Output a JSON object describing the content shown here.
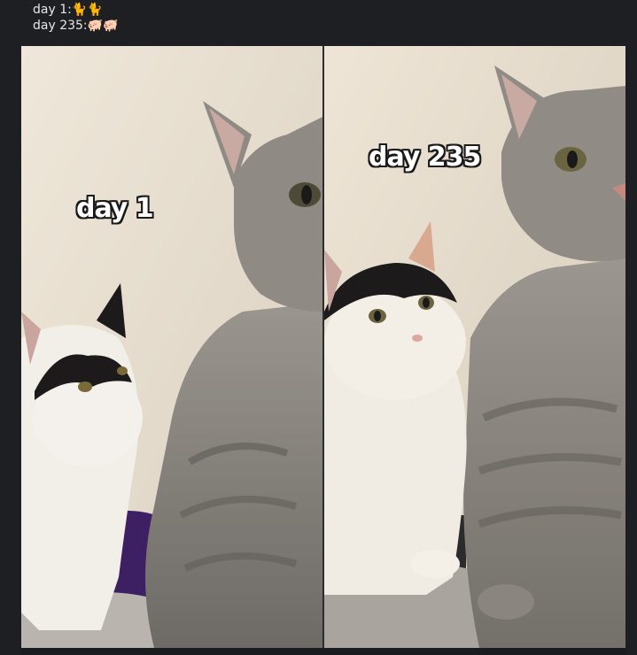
{
  "message": {
    "line1": "day 1:🐈🐈",
    "line2": "day 235:🐖🐖"
  },
  "panels": {
    "left_caption": "day 1",
    "right_caption": "day 235"
  },
  "colors": {
    "background": "#1e1f22",
    "wall": "#e9e0d2",
    "grey_cat": "#8a857f",
    "white_cat": "#f2efe9",
    "black_patch": "#1c1a1a",
    "blanket": "#b9b4ad",
    "purple_cushion": "#3d1f63"
  }
}
